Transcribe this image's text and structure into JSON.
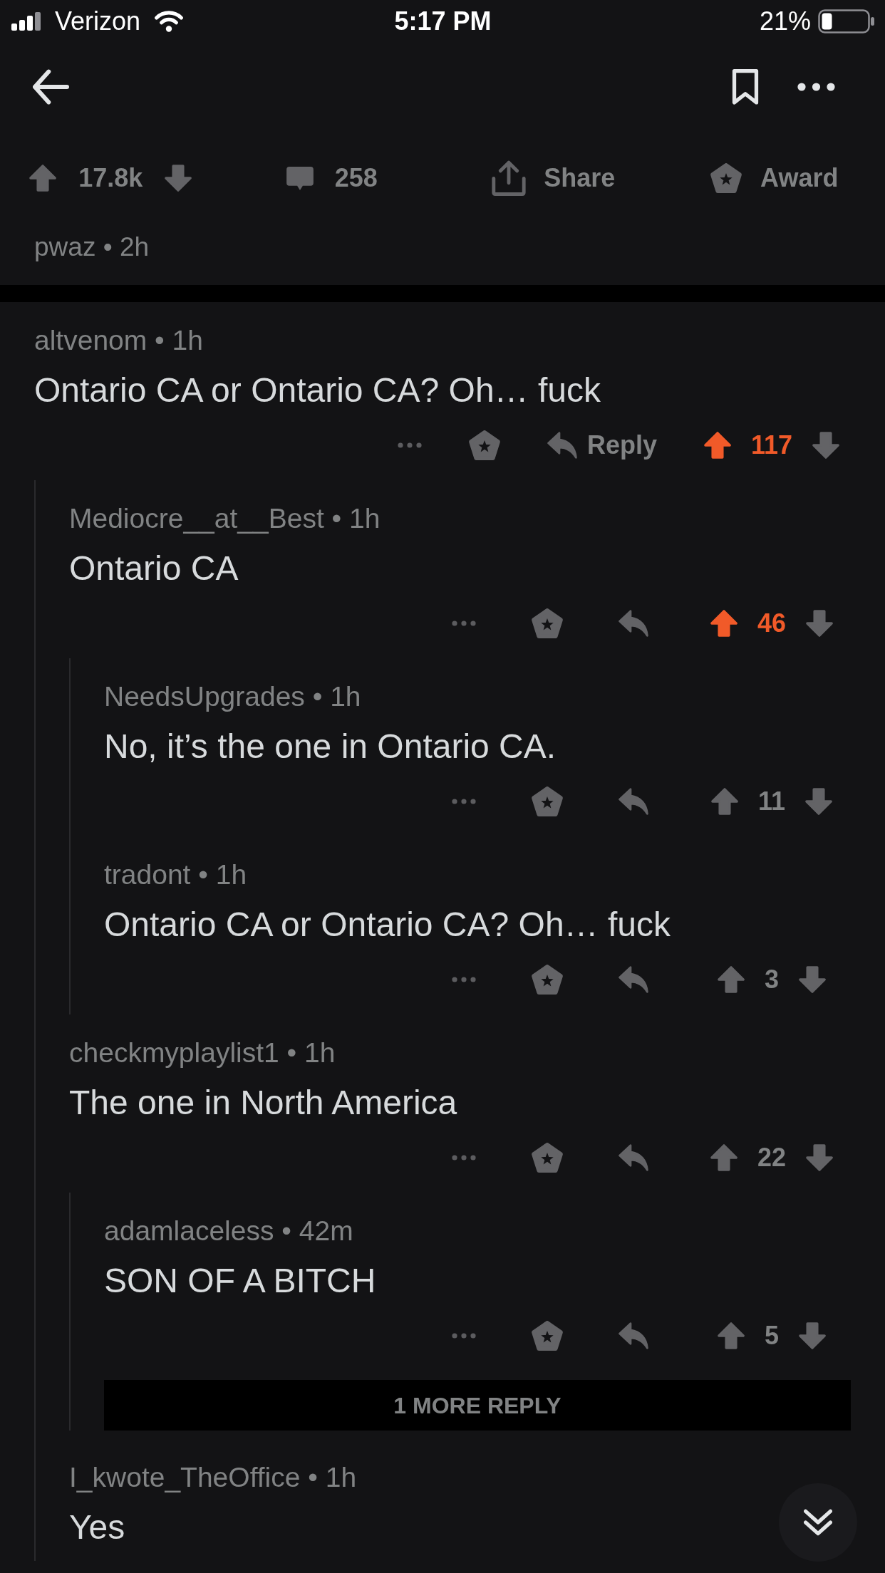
{
  "status_bar": {
    "carrier": "Verizon",
    "time": "5:17 PM",
    "battery": "21%"
  },
  "post": {
    "score": "17.8k",
    "upvoted": false,
    "comments": "258",
    "share": "Share",
    "award": "Award",
    "byline": "pwaz • 2h"
  },
  "comments": [
    {
      "kind": "comment",
      "byline": "altvenom • 1h",
      "body": "Ontario CA or Ontario CA? Oh… fuck",
      "reply_label": "Reply",
      "score": "117",
      "upvoted": true,
      "children": [
        {
          "kind": "comment",
          "byline": "Mediocre__at__Best • 1h",
          "body": "Ontario CA",
          "score": "46",
          "upvoted": true,
          "children": [
            {
              "kind": "comment",
              "byline": "NeedsUpgrades • 1h",
              "body": "No, it’s the one in Ontario CA.",
              "score": "11",
              "upvoted": false
            },
            {
              "kind": "comment",
              "byline": "tradont • 1h",
              "body": "Ontario CA or Ontario CA? Oh… fuck",
              "score": "3",
              "upvoted": false
            }
          ]
        },
        {
          "kind": "comment",
          "byline": "checkmyplaylist1 • 1h",
          "body": "The one in North America",
          "score": "22",
          "upvoted": false,
          "children": [
            {
              "kind": "comment",
              "byline": "adamlaceless • 42m",
              "body": "SON OF A BITCH",
              "score": "5",
              "upvoted": false
            },
            {
              "kind": "more",
              "label": "1 MORE REPLY"
            }
          ]
        },
        {
          "kind": "comment",
          "byline": "I_kwote_TheOffice • 1h",
          "body": "Yes"
        }
      ]
    }
  ]
}
